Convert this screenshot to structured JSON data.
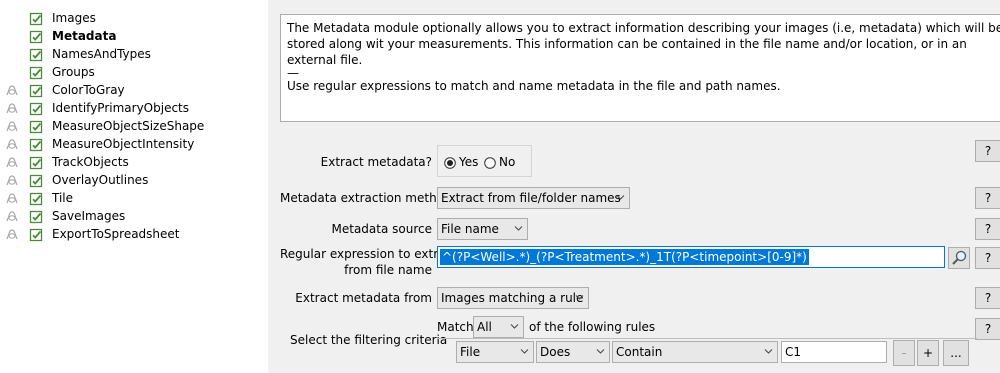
{
  "pipeline": {
    "modules": [
      {
        "name": "Images",
        "bold": false,
        "eye": false
      },
      {
        "name": "Metadata",
        "bold": true,
        "eye": false
      },
      {
        "name": "NamesAndTypes",
        "bold": false,
        "eye": false
      },
      {
        "name": "Groups",
        "bold": false,
        "eye": false
      },
      {
        "name": "ColorToGray",
        "bold": false,
        "eye": true
      },
      {
        "name": "IdentifyPrimaryObjects",
        "bold": false,
        "eye": true
      },
      {
        "name": "MeasureObjectSizeShape",
        "bold": false,
        "eye": true
      },
      {
        "name": "MeasureObjectIntensity",
        "bold": false,
        "eye": true
      },
      {
        "name": "TrackObjects",
        "bold": false,
        "eye": true
      },
      {
        "name": "OverlayOutlines",
        "bold": false,
        "eye": true
      },
      {
        "name": "Tile",
        "bold": false,
        "eye": true
      },
      {
        "name": "SaveImages",
        "bold": false,
        "eye": true
      },
      {
        "name": "ExportToSpreadsheet",
        "bold": false,
        "eye": true
      }
    ]
  },
  "help": {
    "para1": "The Metadata module optionally allows you to extract information describing your images (i.e, metadata) which will be stored along wit your measurements. This information can be contained in the file name and/or location, or in an external file.",
    "separator": "—",
    "para2": "Use regular expressions to match and name metadata in the file and path names."
  },
  "settings": {
    "extract_label": "Extract metadata?",
    "yes_label": "Yes",
    "no_label": "No",
    "method_label": "Metadata extraction method",
    "method_value": "Extract from file/folder names",
    "source_label": "Metadata source",
    "source_value": "File name",
    "regex_label_1": "Regular expression to extract",
    "regex_label_2": "from file name",
    "regex_value": "^(?P<Well>.*)_(?P<Treatment>.*)_1T(?P<timepoint>[0-9]*)",
    "from_label": "Extract metadata from",
    "from_value": "Images matching a rule",
    "filter_label": "Select the filtering criteria",
    "match_label": "Match",
    "match_value": "All",
    "rules_label": "of the following rules",
    "rule_field": "File",
    "rule_op": "Does",
    "rule_cmp": "Contain",
    "rule_value": "C1",
    "minus_label": "-",
    "plus_label": "+",
    "more_label": "...",
    "help_button": "?"
  },
  "colors": {
    "check_green": "#4a8a3a",
    "selection_blue": "#0078d7"
  }
}
